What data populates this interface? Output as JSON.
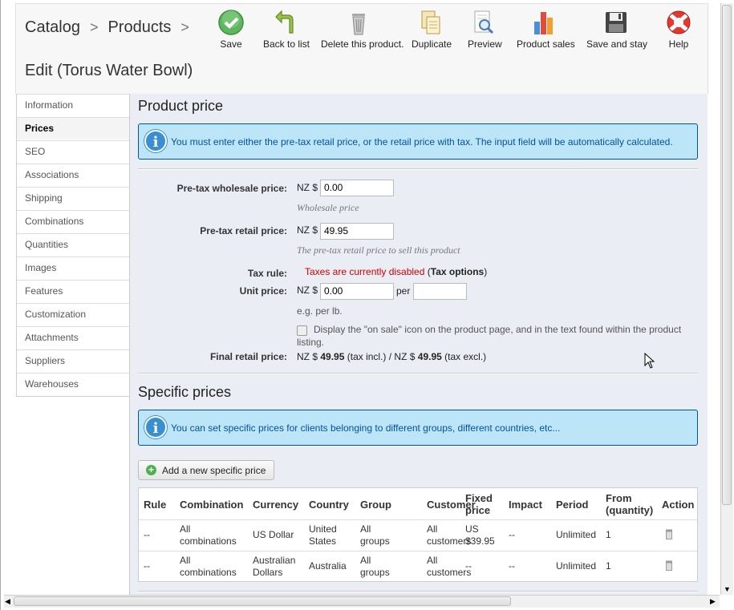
{
  "breadcrumb": {
    "item1": "Catalog",
    "item2": "Products",
    "sep": ">"
  },
  "page_title": "Edit (Torus Water Bowl)",
  "toolbar": {
    "save": "Save",
    "back": "Back to list",
    "delete": "Delete this product.",
    "duplicate": "Duplicate",
    "preview": "Preview",
    "sales": "Product sales",
    "save_stay": "Save and stay",
    "help": "Help"
  },
  "sidebar": {
    "items": [
      {
        "label": "Information"
      },
      {
        "label": "Prices"
      },
      {
        "label": "SEO"
      },
      {
        "label": "Associations"
      },
      {
        "label": "Shipping"
      },
      {
        "label": "Combinations"
      },
      {
        "label": "Quantities"
      },
      {
        "label": "Images"
      },
      {
        "label": "Features"
      },
      {
        "label": "Customization"
      },
      {
        "label": "Attachments"
      },
      {
        "label": "Suppliers"
      },
      {
        "label": "Warehouses"
      }
    ]
  },
  "price": {
    "heading": "Product price",
    "info": "You must enter either the pre-tax retail price, or the retail price with tax. The input field will be automatically calculated.",
    "wholesale_label": "Pre-tax wholesale price:",
    "currency": "NZ $",
    "wholesale_value": "0.00",
    "wholesale_hint": "Wholesale price",
    "retail_label": "Pre-tax retail price:",
    "retail_value": "49.95",
    "retail_hint": "The pre-tax retail price to sell this product",
    "tax_label": "Tax rule:",
    "tax_disabled": "Taxes are currently disabled",
    "tax_open": "(",
    "tax_options": "Tax options",
    "tax_close": ")",
    "unit_label": "Unit price:",
    "unit_value": "0.00",
    "per": "per",
    "per_value": "",
    "unit_hint": "e.g. per lb.",
    "onsale_line1": "Display the \"on sale\" icon on the product page, and in the text found within the product",
    "onsale_line2": "listing.",
    "final_label": "Final retail price:",
    "final_prefix": "NZ $",
    "final_incl": "49.95",
    "final_mid": "(tax incl.) / NZ $",
    "final_excl": "49.95",
    "final_suffix": "(tax excl.)"
  },
  "specific": {
    "heading": "Specific prices",
    "info": "You can set specific prices for clients belonging to different groups, different countries, etc...",
    "add_button": "Add a new specific price",
    "columns": {
      "rule": "Rule",
      "combination": "Combination",
      "currency": "Currency",
      "country": "Country",
      "group": "Group",
      "customer": "Customer",
      "fixed1": "Fixed",
      "fixed2": "price",
      "impact": "Impact",
      "period": "Period",
      "from1": "From",
      "from2": "(quantity)",
      "action": "Action"
    },
    "rows": [
      {
        "rule": "--",
        "comb1": "All",
        "comb2": "combinations",
        "currency1": "US Dollar",
        "currency2": "",
        "country1": "United",
        "country2": "States",
        "group1": "All",
        "group2": "groups",
        "cust1": "All",
        "cust2": "customers",
        "fixed1": "US",
        "fixed2": "$39.95",
        "impact": "--",
        "period": "Unlimited",
        "from": "1"
      },
      {
        "rule": "--",
        "comb1": "All",
        "comb2": "combinations",
        "currency1": "Australian",
        "currency2": "Dollars",
        "country1": "Australia",
        "country2": "",
        "group1": "All",
        "group2": "groups",
        "cust1": "All",
        "cust2": "customers",
        "fixed1": "--",
        "fixed2": "",
        "impact": "--",
        "period": "Unlimited",
        "from": "1"
      }
    ]
  },
  "colors": {
    "info_bg": "#bde5f8",
    "info_text": "#00529b",
    "tax_disabled": "#cc0000",
    "panel_bg": "#ebedf4"
  }
}
